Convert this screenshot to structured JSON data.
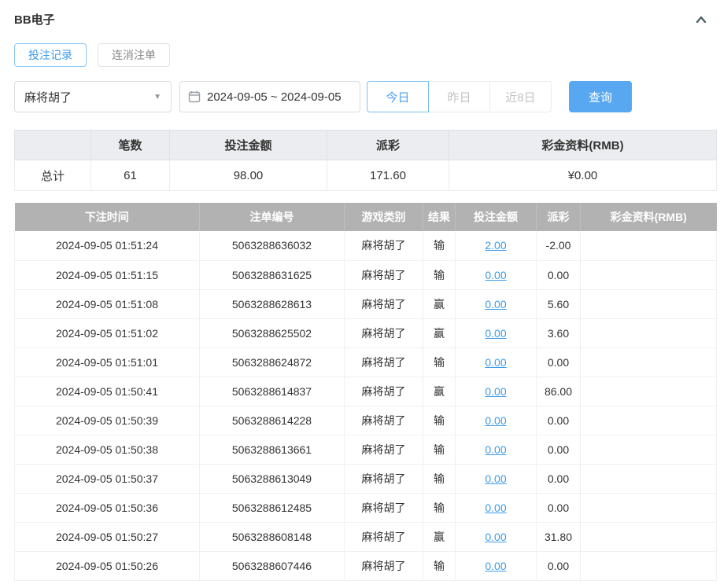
{
  "panel": {
    "title": "BB电子"
  },
  "tabs": [
    {
      "label": "投注记录",
      "active": true
    },
    {
      "label": "连消注单",
      "active": false
    }
  ],
  "filters": {
    "game_select": {
      "value": "麻将胡了"
    },
    "date_range": {
      "value": "2024-09-05 ~ 2024-09-05"
    },
    "quick_buttons": [
      {
        "label": "今日",
        "active": true
      },
      {
        "label": "昨日",
        "active": false
      },
      {
        "label": "近8日",
        "active": false
      }
    ],
    "search_label": "查询"
  },
  "summary": {
    "headers": [
      "",
      "笔数",
      "投注金额",
      "派彩",
      "彩金资料(RMB)"
    ],
    "row": {
      "label": "总计",
      "values": [
        "61",
        "98.00",
        "171.60",
        "¥0.00"
      ]
    }
  },
  "table": {
    "headers": [
      "下注时间",
      "注单编号",
      "游戏类别",
      "结果",
      "投注金额",
      "派彩",
      "彩金资料(RMB)"
    ],
    "rows": [
      {
        "time": "2024-09-05 01:51:24",
        "order_id": "5063288636032",
        "game": "麻将胡了",
        "result": "输",
        "bet": "2.00",
        "payout": "-2.00",
        "payout_negative": true,
        "bonus": ""
      },
      {
        "time": "2024-09-05 01:51:15",
        "order_id": "5063288631625",
        "game": "麻将胡了",
        "result": "输",
        "bet": "0.00",
        "payout": "0.00",
        "payout_negative": false,
        "bonus": ""
      },
      {
        "time": "2024-09-05 01:51:08",
        "order_id": "5063288628613",
        "game": "麻将胡了",
        "result": "赢",
        "bet": "0.00",
        "payout": "5.60",
        "payout_negative": false,
        "bonus": ""
      },
      {
        "time": "2024-09-05 01:51:02",
        "order_id": "5063288625502",
        "game": "麻将胡了",
        "result": "赢",
        "bet": "0.00",
        "payout": "3.60",
        "payout_negative": false,
        "bonus": ""
      },
      {
        "time": "2024-09-05 01:51:01",
        "order_id": "5063288624872",
        "game": "麻将胡了",
        "result": "输",
        "bet": "0.00",
        "payout": "0.00",
        "payout_negative": false,
        "bonus": ""
      },
      {
        "time": "2024-09-05 01:50:41",
        "order_id": "5063288614837",
        "game": "麻将胡了",
        "result": "赢",
        "bet": "0.00",
        "payout": "86.00",
        "payout_negative": false,
        "bonus": ""
      },
      {
        "time": "2024-09-05 01:50:39",
        "order_id": "5063288614228",
        "game": "麻将胡了",
        "result": "输",
        "bet": "0.00",
        "payout": "0.00",
        "payout_negative": false,
        "bonus": ""
      },
      {
        "time": "2024-09-05 01:50:38",
        "order_id": "5063288613661",
        "game": "麻将胡了",
        "result": "输",
        "bet": "0.00",
        "payout": "0.00",
        "payout_negative": false,
        "bonus": ""
      },
      {
        "time": "2024-09-05 01:50:37",
        "order_id": "5063288613049",
        "game": "麻将胡了",
        "result": "输",
        "bet": "0.00",
        "payout": "0.00",
        "payout_negative": false,
        "bonus": ""
      },
      {
        "time": "2024-09-05 01:50:36",
        "order_id": "5063288612485",
        "game": "麻将胡了",
        "result": "输",
        "bet": "0.00",
        "payout": "0.00",
        "payout_negative": false,
        "bonus": ""
      },
      {
        "time": "2024-09-05 01:50:27",
        "order_id": "5063288608148",
        "game": "麻将胡了",
        "result": "赢",
        "bet": "0.00",
        "payout": "31.80",
        "payout_negative": false,
        "bonus": ""
      },
      {
        "time": "2024-09-05 01:50:26",
        "order_id": "5063288607446",
        "game": "麻将胡了",
        "result": "输",
        "bet": "0.00",
        "payout": "0.00",
        "payout_negative": false,
        "bonus": ""
      }
    ]
  },
  "colors": {
    "accent_blue": "#3d9be9",
    "search_button_blue": "#58a8f1",
    "table_header_gray": "#b2b2b2",
    "summary_header_bg": "#ecedf0",
    "negative_red": "#e05353"
  }
}
